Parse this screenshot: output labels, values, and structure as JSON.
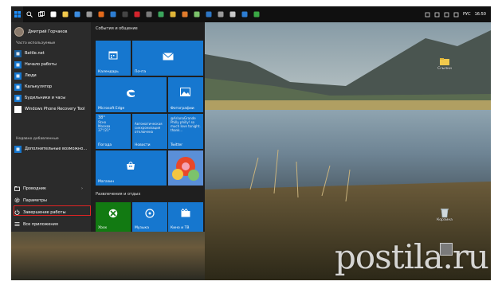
{
  "taskbar": {
    "buttons": [
      {
        "name": "start",
        "icon": "windows-logo-icon",
        "color": "#1e90ff"
      },
      {
        "name": "search",
        "icon": "search-icon",
        "color": "#ffffff"
      },
      {
        "name": "task-view",
        "icon": "task-view-icon",
        "color": "#ffffff"
      },
      {
        "name": "store",
        "icon": "store-bag-icon",
        "color": "#ffffff"
      },
      {
        "name": "file-explorer",
        "icon": "folder-icon",
        "color": "#f2c94c"
      },
      {
        "name": "edge",
        "icon": "edge-icon",
        "color": "#3c8de0"
      },
      {
        "name": "app-grey",
        "icon": "window-icon",
        "color": "#9a9a9a"
      },
      {
        "name": "firefox",
        "icon": "firefox-icon",
        "color": "#e36a1b"
      },
      {
        "name": "mail",
        "icon": "mail-icon",
        "color": "#2d7dd2"
      },
      {
        "name": "app-dark",
        "icon": "app-icon",
        "color": "#444444"
      },
      {
        "name": "opera",
        "icon": "opera-icon",
        "color": "#d3232c"
      },
      {
        "name": "app-grey2",
        "icon": "app-icon",
        "color": "#7a7a7a"
      },
      {
        "name": "chrome",
        "icon": "chrome-icon",
        "color": "#3ba55c"
      },
      {
        "name": "app-yellow",
        "icon": "app-icon",
        "color": "#e0b437"
      },
      {
        "name": "app-orange",
        "icon": "app-icon",
        "color": "#e07b2c"
      },
      {
        "name": "app-paint",
        "icon": "paint-icon",
        "color": "#7cc36b"
      },
      {
        "name": "photoshop",
        "icon": "photoshop-icon",
        "color": "#2d76c4"
      },
      {
        "name": "app-grey3",
        "icon": "app-icon",
        "color": "#9a9a9a"
      },
      {
        "name": "steam",
        "icon": "steam-icon",
        "color": "#c9c9c9"
      },
      {
        "name": "app-blue",
        "icon": "app-icon",
        "color": "#2d7dd2"
      },
      {
        "name": "app-green",
        "icon": "app-icon",
        "color": "#3aa845"
      }
    ],
    "tray": {
      "language": "РУС",
      "time": "16:50",
      "icons": [
        "chevron-up-icon",
        "network-icon",
        "volume-icon",
        "notifications-icon"
      ]
    }
  },
  "start_menu": {
    "user": {
      "name": "Дмитрий Горчаков"
    },
    "most_used_header": "Часто используемые",
    "most_used": [
      {
        "label": "Battle.net",
        "icon": "battlenet-icon",
        "color": "#1b5e9a"
      },
      {
        "label": "Начало работы",
        "icon": "get-started-icon",
        "color": "#1677cf"
      },
      {
        "label": "Люди",
        "icon": "people-icon",
        "color": "#1677cf"
      },
      {
        "label": "Калькулятор",
        "icon": "calculator-icon",
        "color": "#1677cf"
      },
      {
        "label": "Будильники и часы",
        "icon": "alarm-clock-icon",
        "color": "#1677cf"
      },
      {
        "label": "Windows Phone Recovery Tool",
        "icon": "phone-recovery-icon",
        "color": "#ffffff"
      }
    ],
    "recent_header": "Недавно добавленные",
    "recent": [
      {
        "label": "Дополнительные возможно...",
        "icon": "extras-icon",
        "color": "#1677cf"
      }
    ],
    "system": [
      {
        "label": "Проводник",
        "icon": "folder-icon",
        "has_chevron": true
      },
      {
        "label": "Параметры",
        "icon": "gear-icon",
        "has_chevron": false,
        "highlighted": true
      },
      {
        "label": "Завершение работы",
        "icon": "power-icon",
        "has_chevron": false
      },
      {
        "label": "Все приложения",
        "icon": "all-apps-icon",
        "has_chevron": false
      }
    ],
    "group1_header": "События и общение",
    "group2_header": "Развлечения и отдых",
    "tiles": {
      "calendar": {
        "label": "Календарь",
        "icon": "calendar-icon"
      },
      "mail": {
        "label": "Почта",
        "icon": "mail-icon"
      },
      "edge": {
        "label": "Microsoft Edge",
        "icon": "edge-icon"
      },
      "photos": {
        "label": "Фотографии",
        "icon": "photo-icon"
      },
      "weather": {
        "label": "Погода",
        "temp": "38°",
        "lines": [
          "Ясно",
          "Москва",
          "37°/21°"
        ]
      },
      "news": {
        "label": "Новости",
        "text": "Автоматическая синхронизация отключена"
      },
      "twitter": {
        "label": "Twitter",
        "text": "@ArianaGrande Philly philly! so much love tonight. thank..."
      },
      "store": {
        "label": "Магазин",
        "icon": "store-bag-icon"
      },
      "candy": {
        "label": "Candy Crush Saga",
        "icon": "candy-crush-icon"
      },
      "xbox": {
        "label": "Xbox",
        "icon": "xbox-icon"
      },
      "music": {
        "label": "Музыка",
        "icon": "music-icon"
      },
      "movies": {
        "label": "Кино и ТВ",
        "icon": "movies-icon"
      }
    }
  },
  "desktop": {
    "icons": [
      {
        "label": "Ссылки",
        "icon": "folder-icon"
      },
      {
        "label": "Корзина",
        "icon": "recycle-bin-icon"
      }
    ]
  },
  "watermark": "postila.ru",
  "colors": {
    "accent": "#1677cf",
    "tile_green": "#127a12",
    "highlight": "#e02424"
  }
}
